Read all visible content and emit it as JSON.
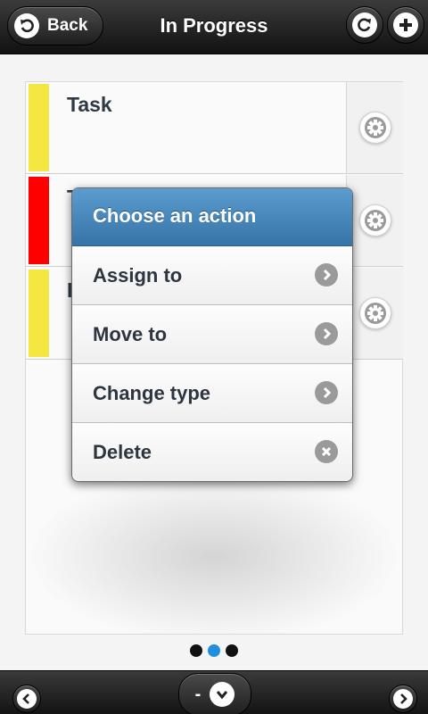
{
  "header": {
    "back_label": "Back",
    "title": "In Progress",
    "refresh_icon": "refresh-icon",
    "add_icon": "plus-icon"
  },
  "tasks": [
    {
      "title": "Task",
      "color": "#f5e642"
    },
    {
      "title": "T",
      "color": "#ff0000"
    },
    {
      "title": "I",
      "color": "#f5e642"
    }
  ],
  "popup": {
    "title": "Choose an action",
    "items": [
      {
        "label": "Assign to",
        "icon": "chevron-right-icon"
      },
      {
        "label": "Move to",
        "icon": "chevron-right-icon"
      },
      {
        "label": "Change type",
        "icon": "chevron-right-icon"
      },
      {
        "label": "Delete",
        "icon": "close-icon"
      }
    ]
  },
  "pager": {
    "pages": 3,
    "active_index": 1
  },
  "footer": {
    "mid_label": "-"
  },
  "colors": {
    "accent": "#3674a8",
    "active_dot": "#1f8fe0"
  }
}
